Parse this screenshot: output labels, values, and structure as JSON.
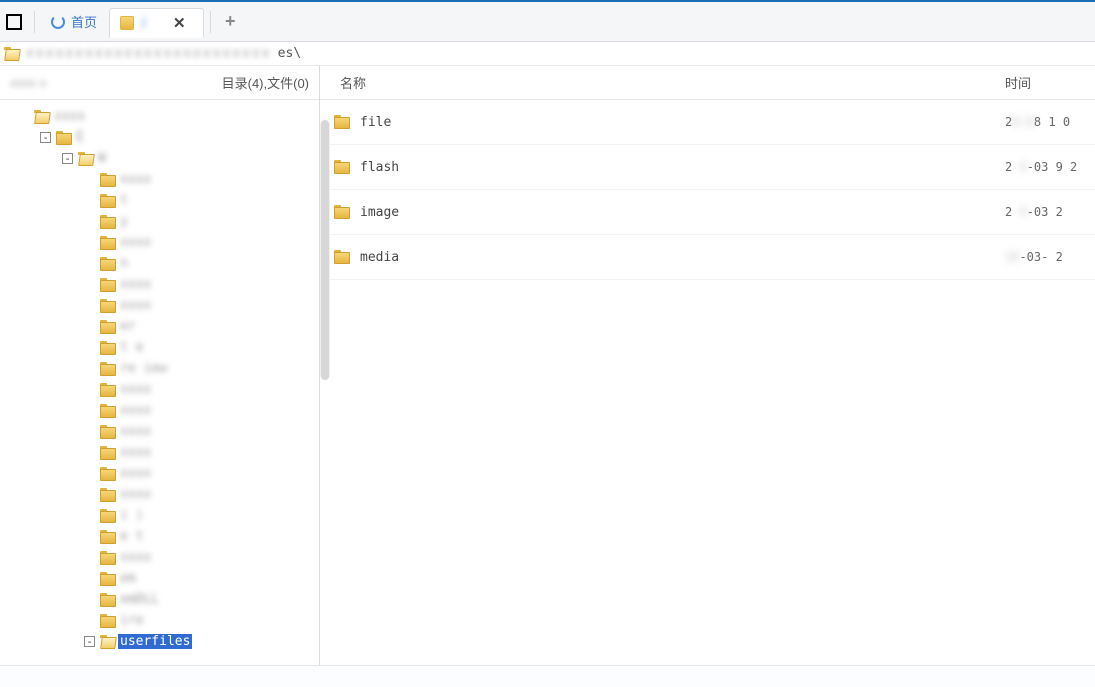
{
  "tabs": {
    "home_label": "首页",
    "active_label": "2",
    "close_glyph": "✕",
    "add_glyph": "+"
  },
  "pathbar": {
    "suffix": "es\\"
  },
  "left": {
    "summary": "目录(4),文件(0)"
  },
  "columns": {
    "name": "名称",
    "time": "时间"
  },
  "tree": [
    {
      "indent": 0,
      "toggle": "",
      "icon": "open",
      "label": "",
      "blur": true
    },
    {
      "indent": 1,
      "toggle": "-",
      "icon": "closed",
      "label": "E",
      "blur": true
    },
    {
      "indent": 2,
      "toggle": "-",
      "icon": "open",
      "label": "W",
      "blur": true
    },
    {
      "indent": 3,
      "toggle": "",
      "icon": "closed",
      "label": "",
      "blur": true
    },
    {
      "indent": 3,
      "toggle": "",
      "icon": "closed",
      "label": "t",
      "blur": true
    },
    {
      "indent": 3,
      "toggle": "",
      "icon": "closed",
      "label": "y",
      "blur": true
    },
    {
      "indent": 3,
      "toggle": "",
      "icon": "closed",
      "label": "",
      "blur": true
    },
    {
      "indent": 3,
      "toggle": "",
      "icon": "closed",
      "label": "n",
      "blur": true
    },
    {
      "indent": 3,
      "toggle": "",
      "icon": "closed",
      "label": "",
      "blur": true
    },
    {
      "indent": 3,
      "toggle": "",
      "icon": "closed",
      "label": "",
      "blur": true
    },
    {
      "indent": 3,
      "toggle": "",
      "icon": "closed",
      "label": "er",
      "blur": true
    },
    {
      "indent": 3,
      "toggle": "",
      "icon": "closed",
      "label": "t  e",
      "blur": true
    },
    {
      "indent": 3,
      "toggle": "",
      "icon": "closed",
      "label": "re iew",
      "blur": true
    },
    {
      "indent": 3,
      "toggle": "",
      "icon": "closed",
      "label": "",
      "blur": true
    },
    {
      "indent": 3,
      "toggle": "",
      "icon": "closed",
      "label": "",
      "blur": true
    },
    {
      "indent": 3,
      "toggle": "",
      "icon": "closed",
      "label": "",
      "blur": true
    },
    {
      "indent": 3,
      "toggle": "",
      "icon": "closed",
      "label": "",
      "blur": true
    },
    {
      "indent": 3,
      "toggle": "",
      "icon": "closed",
      "label": "",
      "blur": true
    },
    {
      "indent": 3,
      "toggle": "",
      "icon": "closed",
      "label": "",
      "blur": true
    },
    {
      "indent": 3,
      "toggle": "",
      "icon": "closed",
      "label": "i )",
      "blur": true
    },
    {
      "indent": 3,
      "toggle": "",
      "icon": "closed",
      "label": "e  t",
      "blur": true
    },
    {
      "indent": 3,
      "toggle": "",
      "icon": "closed",
      "label": "",
      "blur": true
    },
    {
      "indent": 3,
      "toggle": "",
      "icon": "closed",
      "label": "em",
      "blur": true
    },
    {
      "indent": 3,
      "toggle": "",
      "icon": "closed",
      "label": "emDLL",
      "blur": true
    },
    {
      "indent": 3,
      "toggle": "",
      "icon": "closed",
      "label": "ire",
      "blur": true
    },
    {
      "indent": 3,
      "toggle": "-",
      "icon": "open",
      "label": "userfiles",
      "blur": false,
      "selected": true
    }
  ],
  "files": [
    {
      "name": "file",
      "time_pre": "2",
      "time_mid": "0-0",
      "time_suf": "8  1 0"
    },
    {
      "name": "flash",
      "time_pre": "2 ",
      "time_mid": "9",
      "time_suf": "-03  9 2"
    },
    {
      "name": "image",
      "time_pre": "2 ",
      "time_mid": "9",
      "time_suf": "-03    2"
    },
    {
      "name": "media",
      "time_pre": "",
      "time_mid": "19",
      "time_suf": "-03-   2"
    }
  ]
}
